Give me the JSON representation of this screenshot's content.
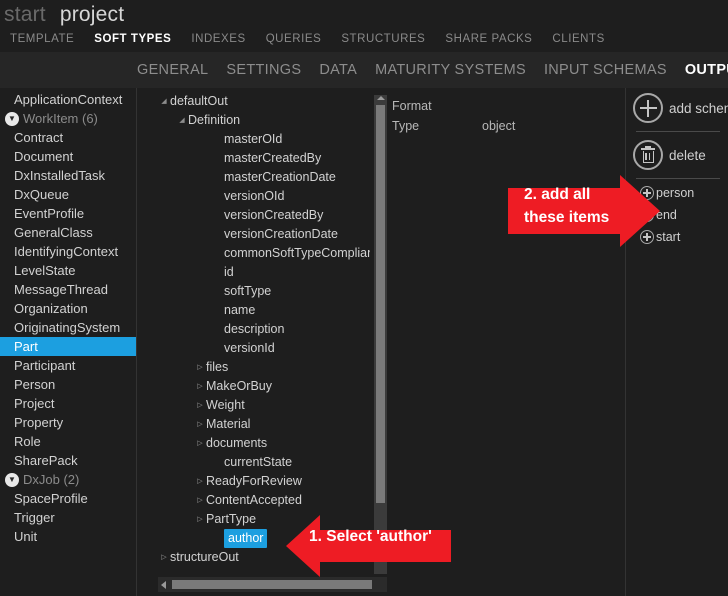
{
  "titlebar": {
    "start": "start",
    "project": "project"
  },
  "tabs_primary": [
    {
      "label": "TEMPLATE",
      "active": false
    },
    {
      "label": "SOFT TYPES",
      "active": true
    },
    {
      "label": "INDEXES",
      "active": false
    },
    {
      "label": "QUERIES",
      "active": false
    },
    {
      "label": "STRUCTURES",
      "active": false
    },
    {
      "label": "SHARE PACKS",
      "active": false
    },
    {
      "label": "CLIENTS",
      "active": false
    }
  ],
  "tabs_secondary": [
    {
      "label": "GENERAL",
      "active": false,
      "clipped": true
    },
    {
      "label": "SETTINGS",
      "active": false
    },
    {
      "label": "DATA",
      "active": false
    },
    {
      "label": "MATURITY SYSTEMS",
      "active": false
    },
    {
      "label": "INPUT SCHEMAS",
      "active": false
    },
    {
      "label": "OUTPUT SCHEMAS",
      "active": true
    }
  ],
  "sidebar": {
    "items": [
      {
        "label": "ApplicationContext",
        "type": "item",
        "selected": false
      },
      {
        "label": "WorkItem (6)",
        "type": "group",
        "selected": false,
        "icon": "chevron-down-icon"
      },
      {
        "label": "Contract",
        "type": "item",
        "selected": false
      },
      {
        "label": "Document",
        "type": "item",
        "selected": false
      },
      {
        "label": "DxInstalledTask",
        "type": "item",
        "selected": false
      },
      {
        "label": "DxQueue",
        "type": "item",
        "selected": false
      },
      {
        "label": "EventProfile",
        "type": "item",
        "selected": false
      },
      {
        "label": "GeneralClass",
        "type": "item",
        "selected": false
      },
      {
        "label": "IdentifyingContext",
        "type": "item",
        "selected": false
      },
      {
        "label": "LevelState",
        "type": "item",
        "selected": false
      },
      {
        "label": "MessageThread",
        "type": "item",
        "selected": false
      },
      {
        "label": "Organization",
        "type": "item",
        "selected": false
      },
      {
        "label": "OriginatingSystem",
        "type": "item",
        "selected": false
      },
      {
        "label": "Part",
        "type": "item",
        "selected": true
      },
      {
        "label": "Participant",
        "type": "item",
        "selected": false
      },
      {
        "label": "Person",
        "type": "item",
        "selected": false
      },
      {
        "label": "Project",
        "type": "item",
        "selected": false
      },
      {
        "label": "Property",
        "type": "item",
        "selected": false
      },
      {
        "label": "Role",
        "type": "item",
        "selected": false
      },
      {
        "label": "SharePack",
        "type": "item",
        "selected": false
      },
      {
        "label": "DxJob (2)",
        "type": "group",
        "selected": false,
        "icon": "chevron-down-icon"
      },
      {
        "label": "SpaceProfile",
        "type": "item",
        "selected": false
      },
      {
        "label": "Trigger",
        "type": "item",
        "selected": false
      },
      {
        "label": "Unit",
        "type": "item",
        "selected": false
      }
    ]
  },
  "tree": {
    "rows": [
      {
        "label": "defaultOut",
        "indent": 0,
        "marker": "expanded",
        "selected": false
      },
      {
        "label": "Definition",
        "indent": 1,
        "marker": "expanded",
        "selected": false
      },
      {
        "label": "masterOId",
        "indent": 3,
        "marker": "none",
        "selected": false
      },
      {
        "label": "masterCreatedBy",
        "indent": 3,
        "marker": "none",
        "selected": false
      },
      {
        "label": "masterCreationDate",
        "indent": 3,
        "marker": "none",
        "selected": false
      },
      {
        "label": "versionOId",
        "indent": 3,
        "marker": "none",
        "selected": false
      },
      {
        "label": "versionCreatedBy",
        "indent": 3,
        "marker": "none",
        "selected": false
      },
      {
        "label": "versionCreationDate",
        "indent": 3,
        "marker": "none",
        "selected": false
      },
      {
        "label": "commonSoftTypeCompliant",
        "indent": 3,
        "marker": "none",
        "selected": false
      },
      {
        "label": "id",
        "indent": 3,
        "marker": "none",
        "selected": false
      },
      {
        "label": "softType",
        "indent": 3,
        "marker": "none",
        "selected": false
      },
      {
        "label": "name",
        "indent": 3,
        "marker": "none",
        "selected": false
      },
      {
        "label": "description",
        "indent": 3,
        "marker": "none",
        "selected": false
      },
      {
        "label": "versionId",
        "indent": 3,
        "marker": "none",
        "selected": false
      },
      {
        "label": "files",
        "indent": 2,
        "marker": "collapsed",
        "selected": false
      },
      {
        "label": "MakeOrBuy",
        "indent": 2,
        "marker": "collapsed",
        "selected": false
      },
      {
        "label": "Weight",
        "indent": 2,
        "marker": "collapsed",
        "selected": false
      },
      {
        "label": "Material",
        "indent": 2,
        "marker": "collapsed",
        "selected": false
      },
      {
        "label": "documents",
        "indent": 2,
        "marker": "collapsed",
        "selected": false
      },
      {
        "label": "currentState",
        "indent": 3,
        "marker": "none",
        "selected": false
      },
      {
        "label": "ReadyForReview",
        "indent": 2,
        "marker": "collapsed",
        "selected": false
      },
      {
        "label": "ContentAccepted",
        "indent": 2,
        "marker": "collapsed",
        "selected": false
      },
      {
        "label": "PartType",
        "indent": 2,
        "marker": "collapsed",
        "selected": false
      },
      {
        "label": "author",
        "indent": 3,
        "marker": "none",
        "selected": true
      },
      {
        "label": "structureOut",
        "indent": 0,
        "marker": "collapsed",
        "selected": false
      }
    ]
  },
  "detail": {
    "rows": [
      {
        "key": "Format",
        "value": ""
      },
      {
        "key": "Type",
        "value": "object"
      }
    ]
  },
  "rightpanel": {
    "add_schema_label": "add schema",
    "delete_label": "delete",
    "items": [
      {
        "label": "person"
      },
      {
        "label": "end"
      },
      {
        "label": "start"
      }
    ]
  },
  "annotations": {
    "one": {
      "text": "1. Select 'author'",
      "color": "#ee1c24"
    },
    "two_line1": "2. add all",
    "two_line2": "these items",
    "two_color": "#ee1c24"
  },
  "colors": {
    "accent_selection": "#1c9fe0",
    "annotation_red": "#ee1c24",
    "background": "#1e1e1e",
    "tabbar_background": "#262626"
  }
}
